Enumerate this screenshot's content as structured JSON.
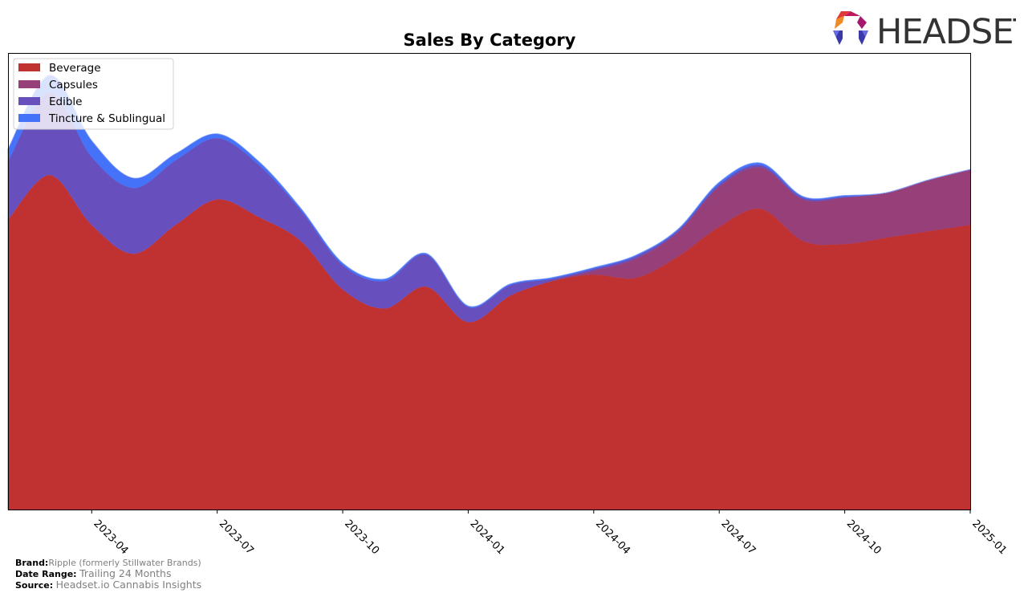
{
  "logo": {
    "text": "HEADSET",
    "icon": "headset-hexagon-logo-icon",
    "colors": [
      "#e03a3a",
      "#f08a24",
      "#c0185c",
      "#8b1a5c",
      "#3a3aa8",
      "#5a5ad0"
    ]
  },
  "footer": {
    "brand_label": "Brand:",
    "brand_value": "Ripple (formerly Stillwater Brands)",
    "date_range_label": "Date Range:",
    "date_range_value": "Trailing 24 Months",
    "source_label": "Source:",
    "source_value": "Headset.io Cannabis Insights"
  },
  "chart_data": {
    "type": "area",
    "stacked": true,
    "title": "Sales By Category",
    "xlabel": "",
    "ylabel": "",
    "y_units": "relative sales (normalized, axis unlabeled)",
    "ylim": [
      0,
      100
    ],
    "grid": false,
    "legend_position": "top-left",
    "x": [
      "2023-02",
      "2023-03",
      "2023-04",
      "2023-05",
      "2023-06",
      "2023-07",
      "2023-08",
      "2023-09",
      "2023-10",
      "2023-11",
      "2023-12",
      "2024-01",
      "2024-02",
      "2024-03",
      "2024-04",
      "2024-05",
      "2024-06",
      "2024-07",
      "2024-08",
      "2024-09",
      "2024-10",
      "2024-11",
      "2024-12",
      "2025-01"
    ],
    "xlim": [
      "2023-02",
      "2025-01"
    ],
    "x_ticks": [
      "2023-04",
      "2023-07",
      "2023-10",
      "2024-01",
      "2024-04",
      "2024-07",
      "2024-10",
      "2025-01"
    ],
    "series": [
      {
        "name": "Beverage",
        "color": "#c03232",
        "values": [
          63.6,
          73.3,
          62.4,
          56.1,
          62.4,
          68.0,
          64.1,
          58.9,
          48.3,
          44.1,
          48.9,
          41.1,
          46.9,
          50.1,
          51.5,
          50.8,
          55.4,
          62.0,
          65.9,
          58.9,
          58.2,
          59.6,
          61.0,
          62.4
        ]
      },
      {
        "name": "Capsules",
        "color": "#963f78",
        "values": [
          0,
          0,
          0,
          0,
          0,
          0,
          0,
          0,
          0,
          0,
          0,
          0,
          0,
          0,
          0.9,
          4.2,
          5.3,
          8.8,
          9.1,
          9.1,
          10.2,
          9.8,
          11.2,
          12.1
        ]
      },
      {
        "name": "Edible",
        "color": "#684fbe",
        "values": [
          12.8,
          18.1,
          14.9,
          14.4,
          14.1,
          13.4,
          11.4,
          6.7,
          5.3,
          6.0,
          7.0,
          3.3,
          2.3,
          0.5,
          0.4,
          0.5,
          0.4,
          0.5,
          0.5,
          0.4,
          0.2,
          0,
          0,
          0
        ]
      },
      {
        "name": "Tincture & Sublingual",
        "color": "#4472f8",
        "values": [
          2.6,
          3.7,
          3.5,
          2.1,
          1.4,
          0.9,
          0.7,
          0.4,
          0.4,
          0.4,
          0.2,
          0.2,
          0.2,
          0.2,
          0.2,
          0.2,
          0.2,
          0.4,
          0.4,
          0.2,
          0.2,
          0,
          0,
          0
        ]
      }
    ]
  }
}
